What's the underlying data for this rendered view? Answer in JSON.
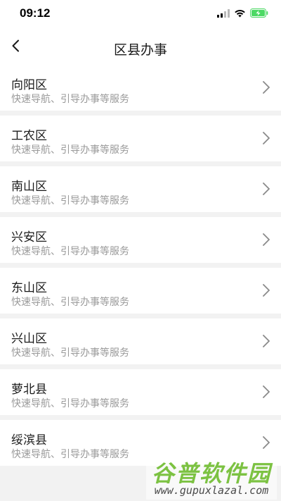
{
  "status_bar": {
    "time": "09:12",
    "icons": [
      "cellular-signal-icon",
      "wifi-icon",
      "battery-charging-icon"
    ],
    "battery_color": "#4cd964"
  },
  "header": {
    "title": "区县办事",
    "back_icon": "chevron-left-icon"
  },
  "districts": [
    {
      "name": "向阳区",
      "desc": "快速导航、引导办事等服务"
    },
    {
      "name": "工农区",
      "desc": "快速导航、引导办事等服务"
    },
    {
      "name": "南山区",
      "desc": "快速导航、引导办事等服务"
    },
    {
      "name": "兴安区",
      "desc": "快速导航、引导办事等服务"
    },
    {
      "name": "东山区",
      "desc": "快速导航、引导办事等服务"
    },
    {
      "name": "兴山区",
      "desc": "快速导航、引导办事等服务"
    },
    {
      "name": "萝北县",
      "desc": "快速导航、引导办事等服务"
    },
    {
      "name": "绥滨县",
      "desc": "快速导航、引导办事等服务"
    }
  ],
  "watermark": {
    "cn": "谷普软件园",
    "url": "www.gupuxlazal.com",
    "color": "#7cc242"
  }
}
